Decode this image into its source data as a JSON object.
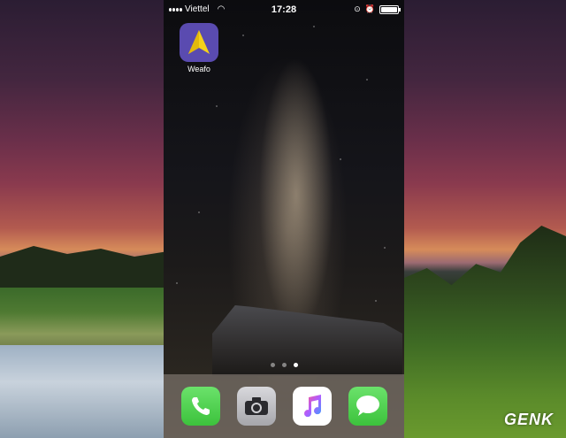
{
  "status_bar": {
    "carrier": "Viettel",
    "time": "17:28"
  },
  "home_screen": {
    "apps": [
      {
        "label": "Weafo",
        "icon": "paper-plane-icon",
        "color": "#5a4bb0"
      }
    ],
    "page_count": 3,
    "active_page": 3
  },
  "dock": {
    "apps": [
      {
        "name": "Phone",
        "icon": "phone-icon"
      },
      {
        "name": "Camera",
        "icon": "camera-icon"
      },
      {
        "name": "Music",
        "icon": "music-note-icon"
      },
      {
        "name": "Messages",
        "icon": "chat-bubble-icon"
      }
    ]
  },
  "watermark": "GENK"
}
